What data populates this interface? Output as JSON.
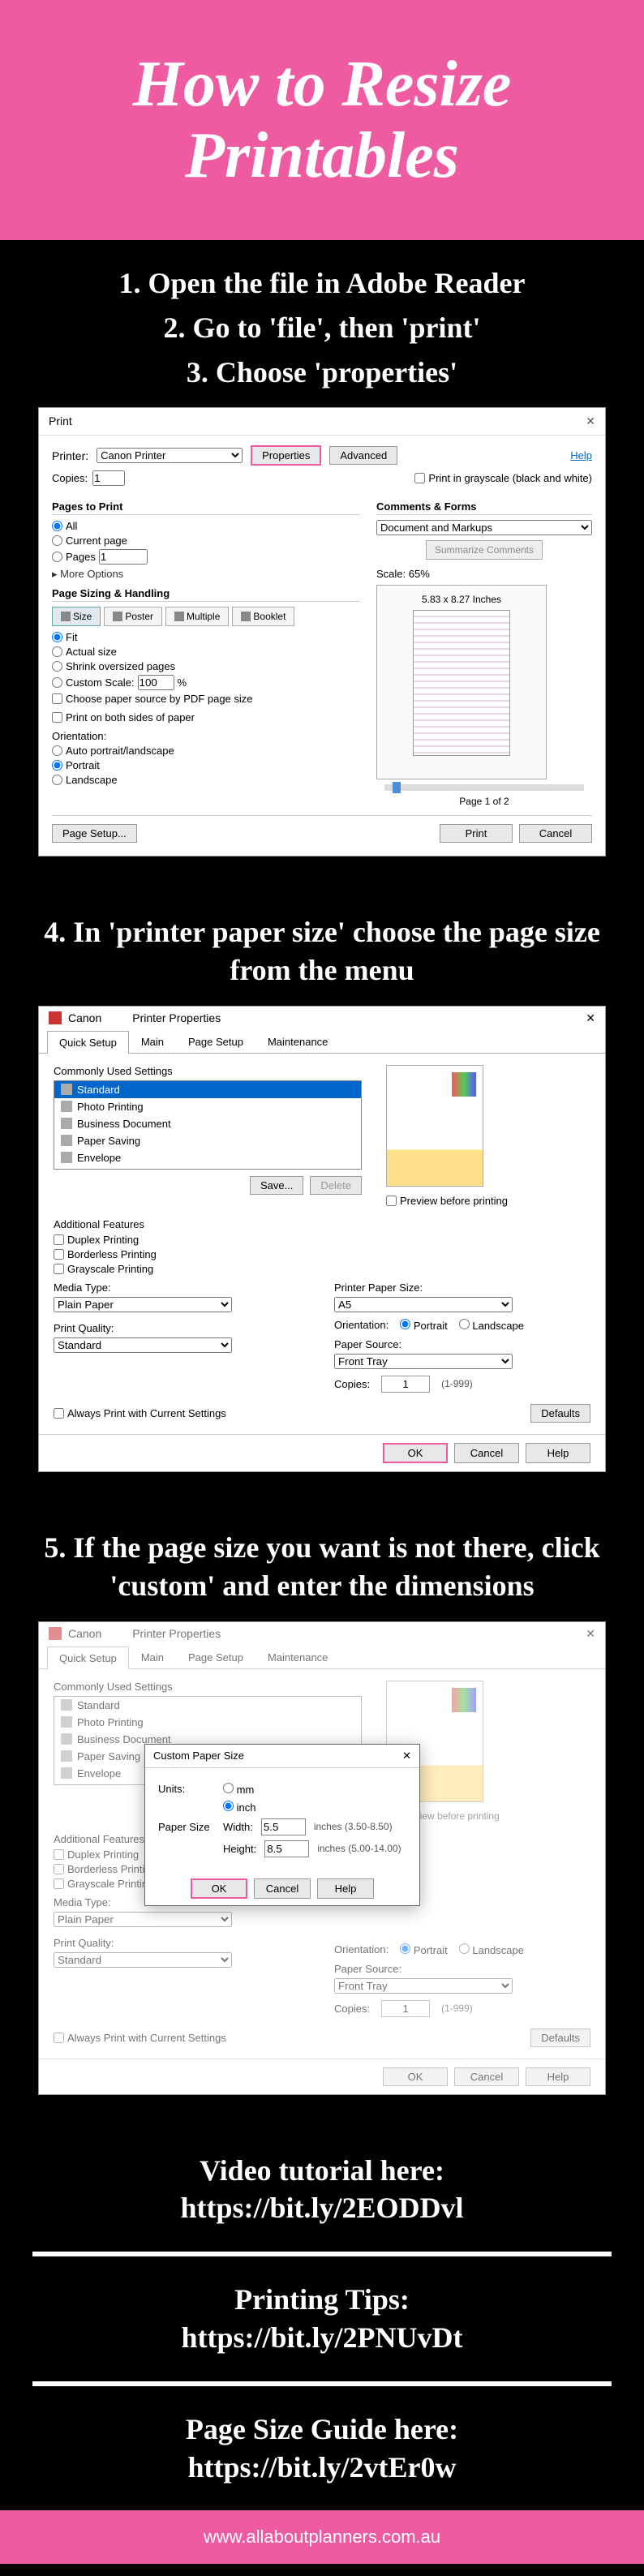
{
  "header": {
    "title": "How to Resize Printables"
  },
  "steps": {
    "s1": "1. Open the file in Adobe Reader",
    "s2": "2. Go to 'file', then 'print'",
    "s3": "3. Choose 'properties'",
    "s4": "4. In 'printer paper size' choose the page size from the menu",
    "s5": "5. If the page size you want is not there, click 'custom' and enter the dimensions"
  },
  "print_dialog": {
    "title": "Print",
    "printer_label": "Printer:",
    "printer_value": "Canon              Printer",
    "btn_properties": "Properties",
    "btn_advanced": "Advanced",
    "help": "Help",
    "copies_label": "Copies:",
    "copies_value": "1",
    "grayscale": "Print in grayscale (black and white)",
    "pages_group": "Pages to Print",
    "r_all": "All",
    "r_current": "Current page",
    "r_pages": "Pages",
    "pages_value": "1",
    "more_options": "▸ More Options",
    "sizing_group": "Page Sizing & Handling",
    "tab_size": "Size",
    "tab_poster": "Poster",
    "tab_multiple": "Multiple",
    "tab_booklet": "Booklet",
    "r_fit": "Fit",
    "r_actual": "Actual size",
    "r_shrink": "Shrink oversized pages",
    "r_custom": "Custom Scale:",
    "custom_val": "100",
    "pct": "%",
    "choose_pdf": "Choose paper source by PDF page size",
    "both_sides": "Print on both sides of paper",
    "orient_label": "Orientation:",
    "r_auto": "Auto portrait/landscape",
    "r_portrait": "Portrait",
    "r_landscape": "Landscape",
    "comments_group": "Comments & Forms",
    "comments_value": "Document and Markups",
    "summarize": "Summarize Comments",
    "scale_label": "Scale: 65%",
    "preview_dim": "5.83 x 8.27 Inches",
    "page_of": "Page 1 of 2",
    "page_setup": "Page Setup...",
    "btn_print": "Print",
    "btn_cancel": "Cancel"
  },
  "props_dialog": {
    "brand": "Canon",
    "title": "Printer Properties",
    "close": "✕",
    "tabs": [
      "Quick Setup",
      "Main",
      "Page Setup",
      "Maintenance"
    ],
    "common_label": "Commonly Used Settings",
    "items": [
      "Standard",
      "Photo Printing",
      "Business Document",
      "Paper Saving",
      "Envelope"
    ],
    "btn_save": "Save...",
    "btn_delete": "Delete",
    "preview_cb": "Preview before printing",
    "addl_label": "Additional Features",
    "addl": [
      "Duplex Printing",
      "Borderless Printing",
      "Grayscale Printing"
    ],
    "media_label": "Media Type:",
    "media_value": "Plain Paper",
    "paper_label": "Printer Paper Size:",
    "paper_value": "A5",
    "orient_label": "Orientation:",
    "orient_portrait": "Portrait",
    "orient_landscape": "Landscape",
    "quality_label": "Print Quality:",
    "quality_value": "Standard",
    "source_label": "Paper Source:",
    "source_value": "Front Tray",
    "copies_label": "Copies:",
    "copies_value": "1",
    "copies_range": "(1-999)",
    "always_cb": "Always Print with Current Settings",
    "btn_defaults": "Defaults",
    "btn_ok": "OK",
    "btn_cancel": "Cancel",
    "btn_help": "Help"
  },
  "custom_paper": {
    "title": "Custom Paper Size",
    "close": "✕",
    "units": "Units:",
    "u_mm": "mm",
    "u_inch": "inch",
    "paper_size": "Paper Size",
    "width": "Width:",
    "width_val": "5.5",
    "width_range": "inches (3.50-8.50)",
    "height": "Height:",
    "height_val": "8.5",
    "height_range": "inches (5.00-14.00)",
    "btn_ok": "OK",
    "btn_cancel": "Cancel",
    "btn_help": "Help"
  },
  "footers": {
    "video_l1": "Video tutorial here:",
    "video_l2": "https://bit.ly/2EODDvl",
    "tips_l1": "Printing Tips:",
    "tips_l2": "https://bit.ly/2PNUvDt",
    "guide_l1": "Page Size Guide here:",
    "guide_l2": "https://bit.ly/2vtEr0w"
  },
  "site_url": "www.allaboutplanners.com.au"
}
